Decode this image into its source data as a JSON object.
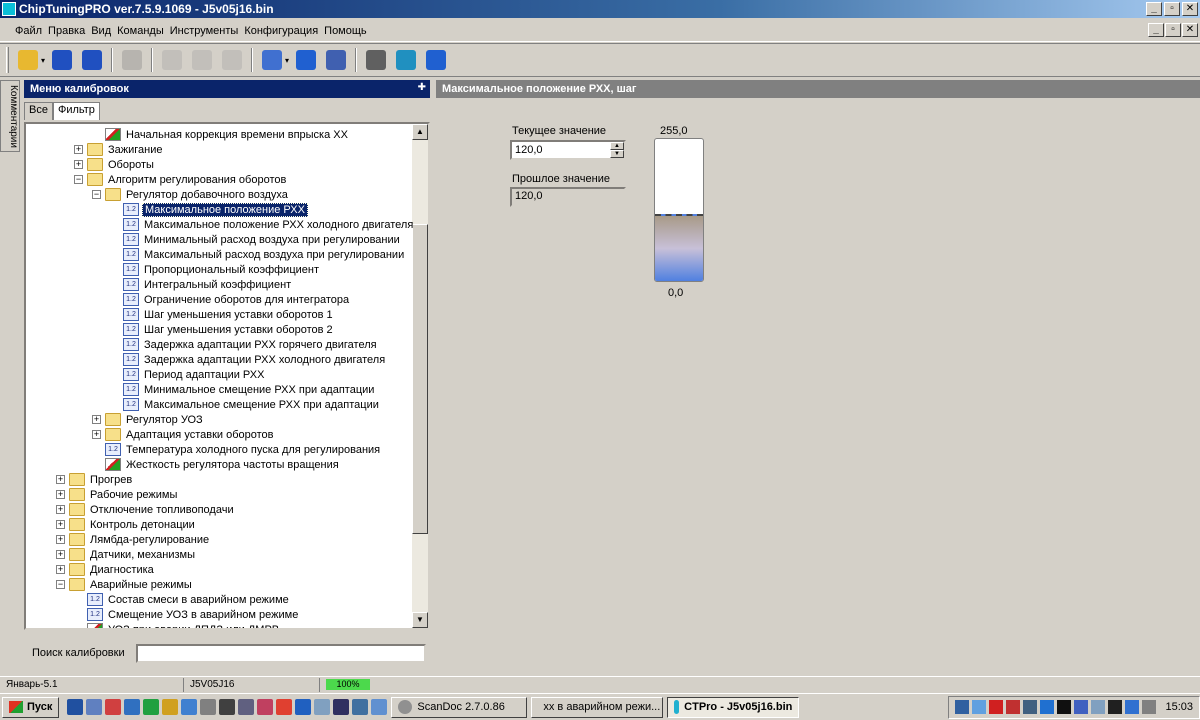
{
  "window": {
    "title": "ChipTuningPRO ver.7.5.9.1069 - J5v05j16.bin",
    "controls": [
      "_",
      "▫",
      "✕"
    ]
  },
  "menu": [
    "Файл",
    "Правка",
    "Вид",
    "Команды",
    "Инструменты",
    "Конфигурация",
    "Помощь"
  ],
  "toolbar": {
    "buttons": [
      {
        "name": "open-icon",
        "color": "#e8b830"
      },
      {
        "name": "save-icon",
        "color": "#2050c0"
      },
      {
        "name": "save-as-icon",
        "color": "#2050c0"
      },
      {
        "name": "print-icon",
        "color": "#808080",
        "disabled": true
      },
      {
        "name": "copy-icon",
        "color": "#a0a0a0",
        "disabled": true
      },
      {
        "name": "paste-icon",
        "color": "#a0a0a0",
        "disabled": true
      },
      {
        "name": "undo-icon",
        "color": "#a0a0a0",
        "disabled": true
      },
      {
        "name": "compare-icon",
        "color": "#4070d0"
      },
      {
        "name": "info-icon",
        "color": "#2060d0"
      },
      {
        "name": "search-icon",
        "color": "#4060b0"
      },
      {
        "name": "tools-icon",
        "color": "#606060"
      },
      {
        "name": "globe-icon",
        "color": "#2090c0"
      },
      {
        "name": "help-icon",
        "color": "#2060d0"
      }
    ]
  },
  "left_tab": "Комментарии",
  "calib_menu": {
    "title": "Меню калибровок",
    "pin": "✚",
    "tabs": [
      "Все",
      "Фильтр"
    ]
  },
  "tree": [
    {
      "level": 2,
      "icon": "graph",
      "label": "Начальная коррекция времени впрыска XX"
    },
    {
      "level": 1,
      "exp": "+",
      "icon": "folder",
      "label": "Зажигание"
    },
    {
      "level": 1,
      "exp": "+",
      "icon": "folder",
      "label": "Обороты"
    },
    {
      "level": 1,
      "exp": "−",
      "icon": "folder",
      "label": "Алгоритм регулирования оборотов"
    },
    {
      "level": 2,
      "exp": "−",
      "icon": "folder",
      "label": "Регулятор добавочного воздуха"
    },
    {
      "level": 3,
      "icon": "param",
      "label": "Максимальное положение РХХ",
      "selected": true
    },
    {
      "level": 3,
      "icon": "param",
      "label": "Максимальное положение РХХ холодного двигателя"
    },
    {
      "level": 3,
      "icon": "param",
      "label": "Минимальный расход воздуха при регулировании"
    },
    {
      "level": 3,
      "icon": "param",
      "label": "Максимальный расход воздуха при регулировании"
    },
    {
      "level": 3,
      "icon": "param",
      "label": "Пропорциональный коэффициент"
    },
    {
      "level": 3,
      "icon": "param",
      "label": "Интегральный коэффициент"
    },
    {
      "level": 3,
      "icon": "param",
      "label": "Ограничение оборотов для интегратора"
    },
    {
      "level": 3,
      "icon": "param",
      "label": "Шаг уменьшения уставки оборотов 1"
    },
    {
      "level": 3,
      "icon": "param",
      "label": "Шаг уменьшения уставки оборотов 2"
    },
    {
      "level": 3,
      "icon": "param",
      "label": "Задержка адаптации РХХ горячего двигателя"
    },
    {
      "level": 3,
      "icon": "param",
      "label": "Задержка адаптации РХХ холодного двигателя"
    },
    {
      "level": 3,
      "icon": "param",
      "label": "Период адаптации РХХ"
    },
    {
      "level": 3,
      "icon": "param",
      "label": "Минимальное смещение РХХ при адаптации"
    },
    {
      "level": 3,
      "icon": "param",
      "label": "Максимальное смещение РХХ при адаптации"
    },
    {
      "level": 2,
      "exp": "+",
      "icon": "folder",
      "label": "Регулятор УОЗ"
    },
    {
      "level": 2,
      "exp": "+",
      "icon": "folder",
      "label": "Адаптация уставки оборотов"
    },
    {
      "level": 2,
      "icon": "param",
      "label": "Температура холодного пуска для регулирования"
    },
    {
      "level": 2,
      "icon": "graph",
      "label": "Жесткость регулятора частоты вращения"
    },
    {
      "level": 0,
      "exp": "+",
      "icon": "folder",
      "label": "Прогрев"
    },
    {
      "level": 0,
      "exp": "+",
      "icon": "folder",
      "label": "Рабочие режимы"
    },
    {
      "level": 0,
      "exp": "+",
      "icon": "folder",
      "label": "Отключение топливоподачи"
    },
    {
      "level": 0,
      "exp": "+",
      "icon": "folder",
      "label": "Контроль детонации"
    },
    {
      "level": 0,
      "exp": "+",
      "icon": "folder",
      "label": "Лямбда-регулирование"
    },
    {
      "level": 0,
      "exp": "+",
      "icon": "folder",
      "label": "Датчики, механизмы"
    },
    {
      "level": 0,
      "exp": "+",
      "icon": "folder",
      "label": "Диагностика"
    },
    {
      "level": 0,
      "exp": "−",
      "icon": "folder",
      "label": "Аварийные режимы"
    },
    {
      "level": 1,
      "icon": "param",
      "label": "Состав смеси в аварийном режиме"
    },
    {
      "level": 1,
      "icon": "param",
      "label": "Смещение УОЗ в аварийном режиме"
    },
    {
      "level": 1,
      "icon": "graph",
      "label": "УОЗ при аварии ДПДЗ или ДМРВ"
    }
  ],
  "search": {
    "label": "Поиск калибровки",
    "value": ""
  },
  "editor": {
    "title": "Максимальное положение РХХ, шаг",
    "current_label": "Текущее значение",
    "current_value": "120,0",
    "previous_label": "Прошлое значение",
    "previous_value": "120,0",
    "gauge_max": "255,0",
    "gauge_min": "0,0",
    "gauge_level": 0.47
  },
  "status": {
    "ecu": "Январь-5.1",
    "file": "J5V05J16",
    "progress": "100%"
  },
  "taskbar": {
    "start": "Пуск",
    "tasks": [
      {
        "label": "ScanDoc 2.7.0.86",
        "color": "#909090"
      },
      {
        "label": "хх в аварийном режи...",
        "color": "#e04030"
      },
      {
        "label": "CTPro - J5v05j16.bin",
        "color": "#20b0d0",
        "active": true
      }
    ],
    "clock": "15:03"
  }
}
